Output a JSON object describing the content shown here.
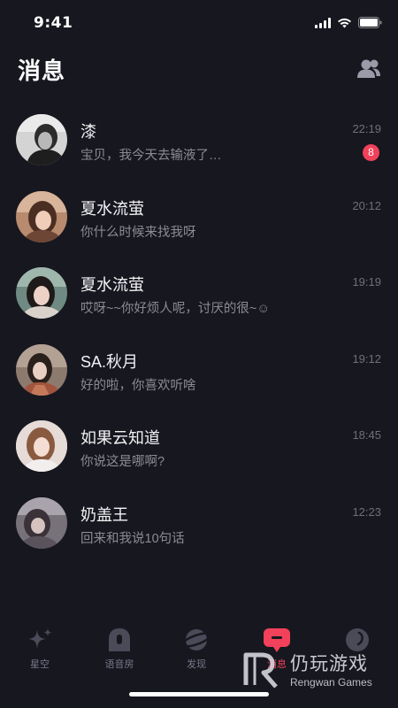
{
  "status_bar": {
    "time": "9:41"
  },
  "header": {
    "title": "消息",
    "contacts_icon": "people-icon"
  },
  "conversations": [
    {
      "name": "漆",
      "preview": "宝贝，我今天去输液了…",
      "time": "22:19",
      "unread": "8"
    },
    {
      "name": "夏水流萤",
      "preview": "你什么时候来找我呀",
      "time": "20:12"
    },
    {
      "name": "夏水流萤",
      "preview": "哎呀~~你好烦人呢，讨厌的很~☺",
      "time": "19:19"
    },
    {
      "name": "SA.秋月",
      "preview": "好的啦，你喜欢听啥",
      "time": "19:12"
    },
    {
      "name": "如果云知道",
      "preview": "你说这是哪啊?",
      "time": "18:45"
    },
    {
      "name": "奶盖王",
      "preview": "回来和我说10句话",
      "time": "12:23"
    }
  ],
  "tabs": [
    {
      "label": "星空",
      "icon": "sparkle-icon"
    },
    {
      "label": "语音房",
      "icon": "voice-room-icon"
    },
    {
      "label": "发现",
      "icon": "planet-icon"
    },
    {
      "label": "消息",
      "icon": "message-icon",
      "active": true
    },
    {
      "label": "",
      "icon": "profile-icon"
    }
  ],
  "watermark": {
    "text": "仍玩游戏",
    "sub": "Rengwan Games"
  },
  "colors": {
    "background": "#17171f",
    "accent": "#f2415a"
  }
}
